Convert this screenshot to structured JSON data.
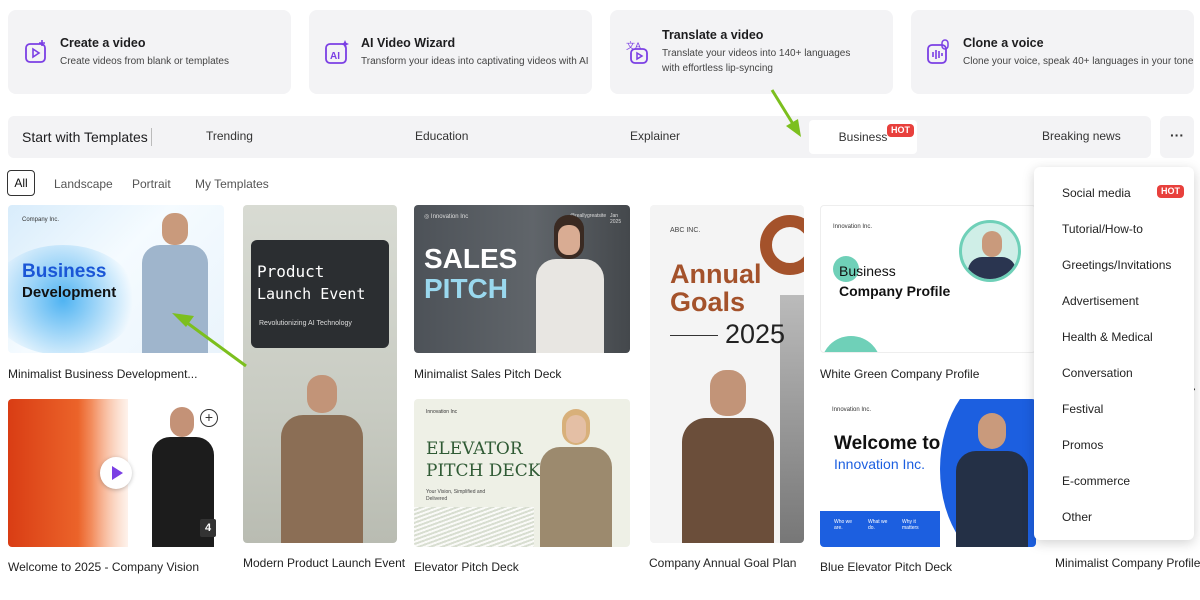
{
  "actions": [
    {
      "title": "Create a video",
      "desc": "Create videos from blank or templates",
      "icon": "create-video-icon"
    },
    {
      "title": "AI Video Wizard",
      "desc": "Transform your ideas into captivating videos with AI",
      "icon": "ai-wizard-icon"
    },
    {
      "title": "Translate a video",
      "desc": "Translate your videos into 140+ languages with effortless lip-syncing",
      "icon": "translate-icon"
    },
    {
      "title": "Clone a voice",
      "desc": "Clone your voice, speak 40+ languages in your tone",
      "icon": "voice-clone-icon"
    }
  ],
  "category_bar": {
    "start": "Start with Templates",
    "tabs": [
      "Trending",
      "Education",
      "Explainer",
      "Business",
      "Breaking news"
    ],
    "active": "Business",
    "hot": "HOT",
    "more": "···"
  },
  "filters": [
    "All",
    "Landscape",
    "Portrait",
    "My Templates"
  ],
  "cards": [
    {
      "title": "Minimalist Business Development...",
      "logo": "Company Inc.",
      "h1": "Business",
      "h2": "Development"
    },
    {
      "title": "Welcome to 2025 - Company Vision",
      "count": "4"
    },
    {
      "title": "Modern Product Launch Event",
      "h1": "Product",
      "h2": "Launch Event",
      "sub": "Revolutionizing AI Technology"
    },
    {
      "title": "Minimalist Sales Pitch Deck",
      "h1": "SALES",
      "h2": "PITCH",
      "meta1": "@reallygreatsite",
      "meta2": "Jan 2025"
    },
    {
      "title": "Elevator Pitch Deck",
      "h1": "ELEVATOR",
      "h2": "PITCH DECK",
      "sub": "Your Vision, Simplified and Delivered",
      "logo": "Innovation Inc"
    },
    {
      "title": "Company Annual Goal Plan",
      "logo": "ABC INC.",
      "h1": "Annual",
      "h2": "Goals",
      "year": "2025"
    },
    {
      "title": "White Green Company Profile",
      "logo": "Innovation Inc.",
      "h1": "Business",
      "h2": "Company Profile"
    },
    {
      "title": "Blue Elevator Pitch Deck",
      "logo": "Innovation Inc.",
      "h1": "Welcome to",
      "h2": "Innovation Inc.",
      "cols": [
        "Who we are.",
        "What we do.",
        "Why it matters"
      ]
    },
    {
      "title": "Minimalist Company Profile"
    }
  ],
  "dropdown": {
    "items": [
      "Social media",
      "Tutorial/How-to",
      "Greetings/Invitations",
      "Advertisement",
      "Health & Medical",
      "Conversation",
      "Festival",
      "Promos",
      "E-commerce",
      "Other"
    ],
    "hot": "HOT"
  },
  "colors": {
    "accent": "#7b3fe4",
    "hot": "#e8403c",
    "arrow": "#7cbf1e",
    "card_bg": "#f3f3f5"
  }
}
